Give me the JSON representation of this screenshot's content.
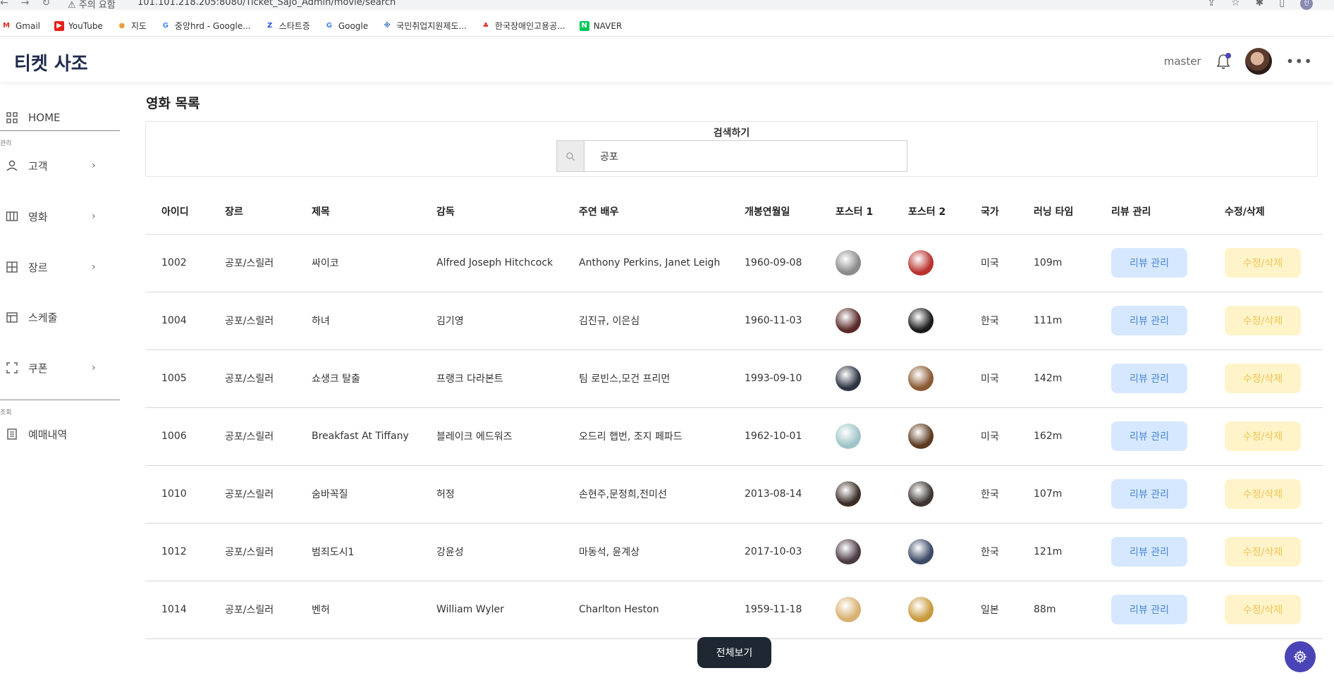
{
  "browser": {
    "warning": "주의 요함",
    "url": "101.101.218.205:8080/Ticket_SaJo_Admin/movie/search",
    "bookmarks": [
      "Gmail",
      "YouTube",
      "지도",
      "중앙hrd - Google...",
      "스타트증",
      "Google",
      "국민취업지원제도...",
      "한국장애인고용공...",
      "NAVER"
    ]
  },
  "header": {
    "brand": "티켓 사조",
    "username": "master"
  },
  "sidebar": {
    "home": "HOME",
    "section_manage": "관리",
    "customers": "고객",
    "movies": "영화",
    "genres": "장르",
    "schedule": "스케줄",
    "coupons": "쿠폰",
    "section_view": "조회",
    "reservations": "예매내역"
  },
  "main": {
    "title": "영화 목록",
    "search_label": "검색하기",
    "search_value": "공포",
    "columns": [
      "아이디",
      "장르",
      "제목",
      "감독",
      "주연 배우",
      "개봉연월일",
      "포스터 1",
      "포스터 2",
      "국가",
      "러닝 타임",
      "리뷰 관리",
      "수정/삭제"
    ],
    "review_button": "리뷰 관리",
    "edit_button": "수정/삭제",
    "show_all_button": "전체보기",
    "rows": [
      {
        "id": "1002",
        "genre": "공포/스릴러",
        "title": "싸이코",
        "director": "Alfred Joseph Hitchcock",
        "cast": "Anthony Perkins, Janet Leigh",
        "release": "1960-09-08",
        "country": "미국",
        "runtime": "109m",
        "poster1": "#8a8a8a",
        "poster2": "#b8322e"
      },
      {
        "id": "1004",
        "genre": "공포/스릴러",
        "title": "하녀",
        "director": "김기영",
        "cast": "김진규, 이은심",
        "release": "1960-11-03",
        "country": "한국",
        "runtime": "111m",
        "poster1": "#5a2a2a",
        "poster2": "#1a1a1a"
      },
      {
        "id": "1005",
        "genre": "공포/스릴러",
        "title": "쇼생크 탈출",
        "director": "프랭크 다라본트",
        "cast": "팀 로빈스,모건 프리먼",
        "release": "1993-09-10",
        "country": "미국",
        "runtime": "142m",
        "poster1": "#2c3442",
        "poster2": "#8a5a34"
      },
      {
        "id": "1006",
        "genre": "공포/스릴러",
        "title": "Breakfast At Tiffany",
        "director": "블레이크 에드워즈",
        "cast": "오드리 햅번, 조지 페파드",
        "release": "1962-10-01",
        "country": "미국",
        "runtime": "162m",
        "poster1": "#9fc4c8",
        "poster2": "#5c3a20"
      },
      {
        "id": "1010",
        "genre": "공포/스릴러",
        "title": "숨바꼭질",
        "director": "허정",
        "cast": "손현주,문정희,전미선",
        "release": "2013-08-14",
        "country": "한국",
        "runtime": "107m",
        "poster1": "#3a2e26",
        "poster2": "#3c3430"
      },
      {
        "id": "1012",
        "genre": "공포/스릴러",
        "title": "범죄도시1",
        "director": "강윤성",
        "cast": "마동석, 윤계상",
        "release": "2017-10-03",
        "country": "한국",
        "runtime": "121m",
        "poster1": "#4a3a44",
        "poster2": "#3c4a66"
      },
      {
        "id": "1014",
        "genre": "공포/스릴러",
        "title": "벤허",
        "director": "William Wyler",
        "cast": "Charlton Heston",
        "release": "1959-11-18",
        "country": "일본",
        "runtime": "88m",
        "poster1": "#d8b070",
        "poster2": "#c89a3c"
      }
    ]
  },
  "colors": {
    "brand": "#1f2b4d",
    "accent": "#4b44b6",
    "review_bg": "#d6e8ff",
    "edit_bg": "#fff3c9"
  }
}
